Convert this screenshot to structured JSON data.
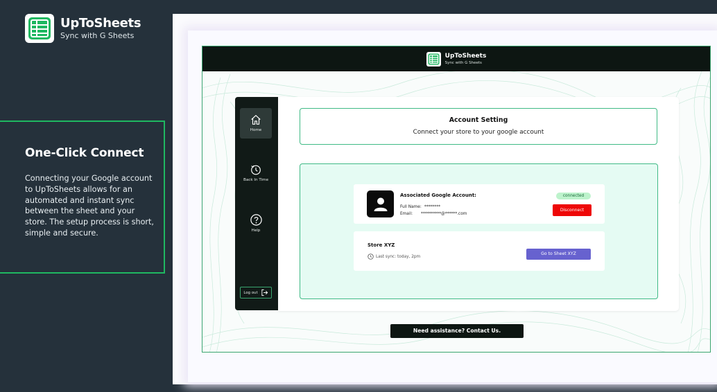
{
  "brand": {
    "name": "UpToSheets",
    "tagline": "Sync with G Sheets",
    "accent_color": "#1fb861"
  },
  "feature": {
    "title": "One-Click Connect",
    "description": "Connecting your Google account to UpToSheets allows for an automated and instant sync between the sheet and your store. The setup process is short, simple and secure."
  },
  "app": {
    "header": {
      "name": "UpToSheets",
      "tagline": "Sync with G Sheets"
    },
    "sidebar": {
      "items": [
        {
          "label": "Home",
          "icon": "home-icon",
          "active": true
        },
        {
          "label": "Back In Time",
          "icon": "history-icon",
          "active": false
        },
        {
          "label": "Help",
          "icon": "help-icon",
          "active": false
        }
      ],
      "logout_label": "Log out"
    },
    "account_setting": {
      "title": "Account Setting",
      "subtitle": "Connect your store to your google account"
    },
    "account": {
      "title": "Associated Google Account:",
      "full_name_label": "Full Name:",
      "full_name_value": "********",
      "email_label": "Email:",
      "email_value": "**********@******.com",
      "status": "connected",
      "disconnect_label": "Disconnect"
    },
    "store": {
      "name": "Store XYZ",
      "last_sync": "Last sync: today, 2pm",
      "button_label": "Go to Sheet XYZ"
    },
    "help_label": "Need assistance? Contact Us."
  },
  "colors": {
    "background": "#25313b",
    "header": "#0d1612",
    "disconnect": "#ee0707",
    "primary_button": "#6762cf",
    "connected_badge": "#bdf3cc"
  }
}
